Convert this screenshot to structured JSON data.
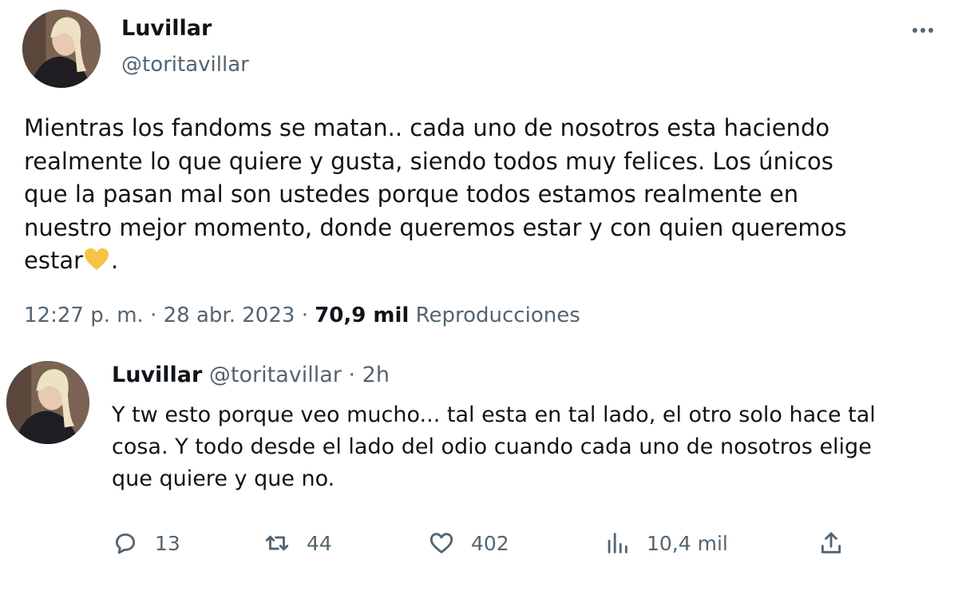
{
  "main_tweet": {
    "author_name": "Luvillar",
    "handle": "@toritavillar",
    "text_before_emoji": "Mientras los fandoms se matan.. cada uno de nosotros esta haciendo\nrealmente lo que quiere y gusta, siendo todos muy felices. Los únicos\nque la pasan mal son ustedes porque todos estamos realmente en\nnuestro mejor momento, donde queremos estar y con quien queremos\nestar",
    "emoji": "yellow-heart",
    "text_after_emoji": ".",
    "time": "12:27 p. m.",
    "separator": "·",
    "date": "28 abr. 2023",
    "views_count": "70,9 mil",
    "views_label": "Reproducciones"
  },
  "reply_tweet": {
    "author_name": "Luvillar",
    "handle": "@toritavillar",
    "separator": "·",
    "age": "2h",
    "text": "Y tw esto porque veo mucho... tal esta en tal lado, el otro solo hace tal\ncosa. Y todo desde el lado del odio cuando cada uno de nosotros elige\nque quiere y que no.",
    "actions": {
      "replies": "13",
      "retweets": "44",
      "likes": "402",
      "views": "10,4 mil"
    }
  },
  "icons": {
    "more": "more-horizontal-icon",
    "reply": "speech-bubble-icon",
    "retweet": "retweet-icon",
    "like": "heart-icon",
    "views": "bar-chart-icon",
    "share": "share-upload-icon"
  },
  "colors": {
    "text_primary": "#0f1419",
    "text_secondary": "#536471",
    "emoji_yellow": "#f6c442"
  }
}
